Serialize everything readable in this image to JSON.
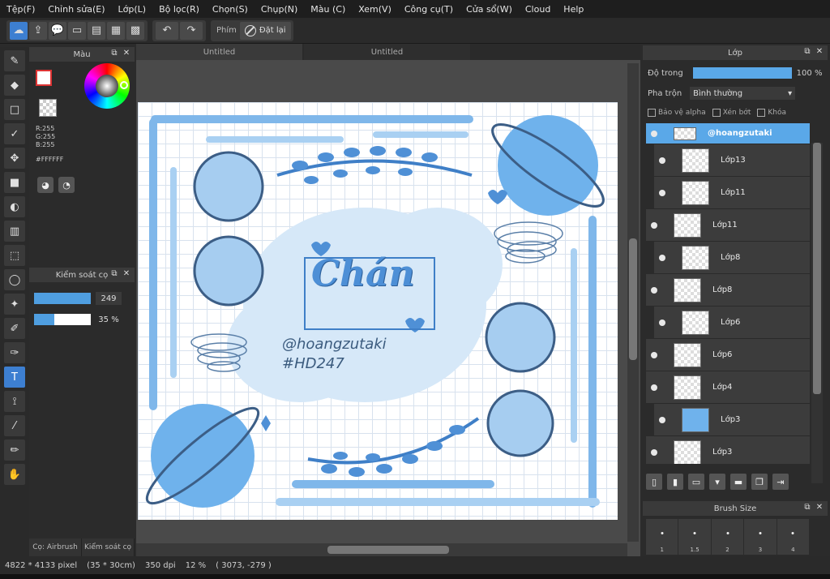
{
  "menu": [
    "Tệp(F)",
    "Chỉnh sửa(E)",
    "Lớp(L)",
    "Bộ lọc(R)",
    "Chọn(S)",
    "Chụp(N)",
    "Màu (C)",
    "Xem(V)",
    "Công cụ(T)",
    "Cửa sổ(W)",
    "Cloud",
    "Help"
  ],
  "toolbar": {
    "phim_label": "Phím",
    "reset_label": "Đặt lại"
  },
  "color_panel": {
    "title": "Màu",
    "r": "R:255",
    "g": "G:255",
    "b": "B:255",
    "hex": "#FFFFFF"
  },
  "brush_control": {
    "title": "Kiểm soát cọ",
    "size_value": "249",
    "size_fraction": 1.0,
    "opacity_value": "35 %",
    "opacity_fraction": 0.35
  },
  "bottom_tabs": [
    "Cọ: Airbrush",
    "Kiểm soát cọ"
  ],
  "doc_tabs": [
    "Untitled",
    "Untitled"
  ],
  "artwork": {
    "title": "Chán",
    "handle": "@hoangzutaki",
    "tag": "#HD247"
  },
  "layer_panel": {
    "title": "Lớp",
    "opacity_label": "Độ trong",
    "opacity_value": "100 %",
    "opacity_fraction": 1.0,
    "blend_label": "Pha trộn",
    "blend_value": "Bình thường",
    "protect_alpha": "Bảo vệ alpha",
    "clip": "Xén bớt",
    "lock": "Khóa",
    "layers": [
      {
        "name": "@hoangzutaki",
        "selected": true
      },
      {
        "name": "Lớp13",
        "child": true
      },
      {
        "name": "Lớp11",
        "child": true
      },
      {
        "name": "Lớp11"
      },
      {
        "name": "Lớp8",
        "child": true
      },
      {
        "name": "Lớp8"
      },
      {
        "name": "Lớp6",
        "child": true
      },
      {
        "name": "Lớp6"
      },
      {
        "name": "Lớp4"
      },
      {
        "name": "Lớp3",
        "child": true,
        "blue": true
      },
      {
        "name": "Lớp3"
      }
    ]
  },
  "brush_size": {
    "title": "Brush Size",
    "sizes": [
      "1",
      "1.5",
      "2",
      "3",
      "4"
    ]
  },
  "status": {
    "dims": "4822 * 4133 pixel",
    "cm": "(35 * 30cm)",
    "dpi": "350 dpi",
    "zoom": "12 %",
    "coords": "( 3073, -279 )"
  }
}
